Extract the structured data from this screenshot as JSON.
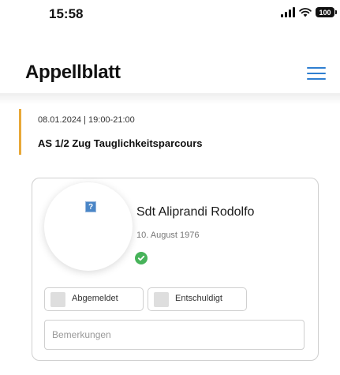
{
  "status_bar": {
    "time": "15:58",
    "battery_level": "100",
    "icons": [
      "signal-icon",
      "wifi-icon",
      "battery-icon"
    ]
  },
  "header": {
    "title": "Appellblatt",
    "menu_icon": "hamburger-menu-icon"
  },
  "event": {
    "date_time": "08.01.2024 | 19:00-21:00",
    "title": "AS 1/2 Zug Tauglichkeitsparcours"
  },
  "person_card": {
    "name": "Sdt Aliprandi Rodolfo",
    "birth_date": "10. August 1976",
    "avatar_placeholder": "?",
    "status_icon": "check-circle-icon",
    "buttons": {
      "abgemeldet": "Abgemeldet",
      "entschuldigt": "Entschuldigt"
    },
    "remarks": {
      "placeholder": "Bemerkungen",
      "value": ""
    }
  },
  "colors": {
    "accent_orange": "#e8a838",
    "menu_blue": "#2f7fd1",
    "status_green": "#47b35a"
  }
}
